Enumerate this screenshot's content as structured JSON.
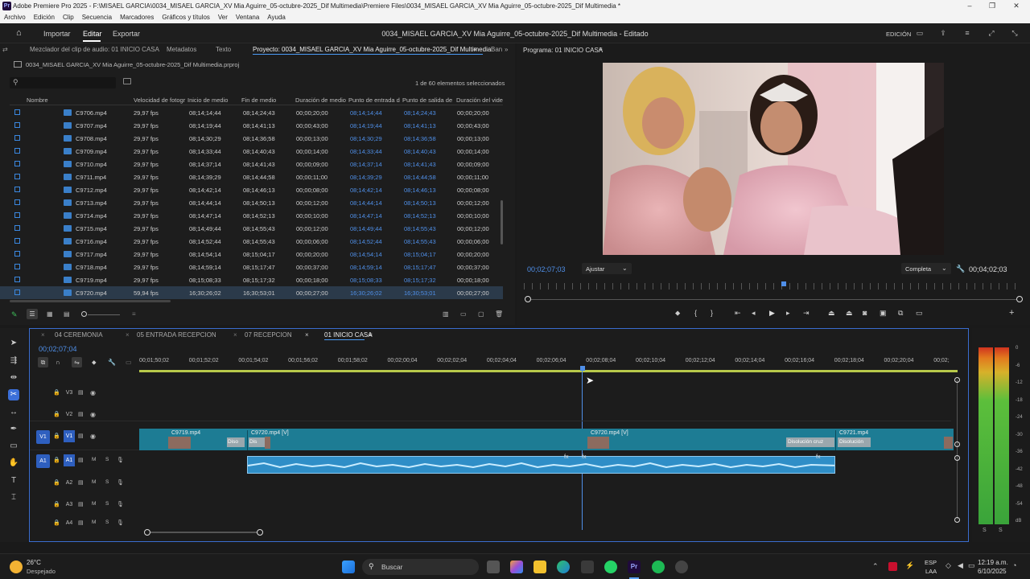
{
  "window": {
    "title": "Adobe Premiere Pro 2025 - F:\\MISAEL GARCIA\\0034_MISAEL GARCIA_XV Mia Aguirre_05-octubre-2025_Dif Multimedia\\Premiere Files\\0034_MISAEL GARCIA_XV Mia Aguirre_05-octubre-2025_Dif Multimedia *",
    "logo": "Pr"
  },
  "menu": [
    "Archivo",
    "Edición",
    "Clip",
    "Secuencia",
    "Marcadores",
    "Gráficos y títulos",
    "Ver",
    "Ventana",
    "Ayuda"
  ],
  "appbar": {
    "tabs": [
      "Importar",
      "Editar",
      "Exportar"
    ],
    "active_tab": "Editar",
    "project_title": "0034_MISAEL GARCIA_XV Mia Aguirre_05-octubre-2025_Dif Multimedia - Editado",
    "workspace": "EDICIÓN"
  },
  "project_panel": {
    "tabs": [
      "Mezclador del clip de audio: 01 INICIO CASA",
      "Metadatos",
      "Texto",
      "Proyecto: 0034_MISAEL GARCIA_XV Mia Aguirre_05-octubre-2025_Dif Multimedia",
      "Ban"
    ],
    "file": "0034_MISAEL GARCIA_XV Mia Aguirre_05-octubre-2025_Dif Multimedia.prproj",
    "selection_status": "1 de 60 elementos seleccionados",
    "columns": [
      "Nombre",
      "Velocidad de fotogr",
      "Inicio de medio",
      "Fin de medio",
      "Duración de medio",
      "Punto de entrada d",
      "Punto de salida de",
      "Duración del vide"
    ],
    "rows": [
      [
        "C9706.mp4",
        "29,97 fps",
        "08;14;14;44",
        "08;14;24;43",
        "00;00;20;00",
        "08;14;14;44",
        "08;14;24;43",
        "00;00;20;00"
      ],
      [
        "C9707.mp4",
        "29,97 fps",
        "08;14;19;44",
        "08;14;41;13",
        "00;00;43;00",
        "08;14;19;44",
        "08;14;41;13",
        "00;00;43;00"
      ],
      [
        "C9708.mp4",
        "29,97 fps",
        "08;14;30;29",
        "08;14;36;58",
        "00;00;13;00",
        "08;14;30;29",
        "08;14;36;58",
        "00;00;13;00"
      ],
      [
        "C9709.mp4",
        "29,97 fps",
        "08;14;33;44",
        "08;14;40;43",
        "00;00;14;00",
        "08;14;33;44",
        "08;14;40;43",
        "00;00;14;00"
      ],
      [
        "C9710.mp4",
        "29,97 fps",
        "08;14;37;14",
        "08;14;41;43",
        "00;00;09;00",
        "08;14;37;14",
        "08;14;41;43",
        "00;00;09;00"
      ],
      [
        "C9711.mp4",
        "29,97 fps",
        "08;14;39;29",
        "08;14;44;58",
        "00;00;11;00",
        "08;14;39;29",
        "08;14;44;58",
        "00;00;11;00"
      ],
      [
        "C9712.mp4",
        "29,97 fps",
        "08;14;42;14",
        "08;14;46;13",
        "00;00;08;00",
        "08;14;42;14",
        "08;14;46;13",
        "00;00;08;00"
      ],
      [
        "C9713.mp4",
        "29,97 fps",
        "08;14;44;14",
        "08;14;50;13",
        "00;00;12;00",
        "08;14;44;14",
        "08;14;50;13",
        "00;00;12;00"
      ],
      [
        "C9714.mp4",
        "29,97 fps",
        "08;14;47;14",
        "08;14;52;13",
        "00;00;10;00",
        "08;14;47;14",
        "08;14;52;13",
        "00;00;10;00"
      ],
      [
        "C9715.mp4",
        "29,97 fps",
        "08;14;49;44",
        "08;14;55;43",
        "00;00;12;00",
        "08;14;49;44",
        "08;14;55;43",
        "00;00;12;00"
      ],
      [
        "C9716.mp4",
        "29,97 fps",
        "08;14;52;44",
        "08;14;55;43",
        "00;00;06;00",
        "08;14;52;44",
        "08;14;55;43",
        "00;00;06;00"
      ],
      [
        "C9717.mp4",
        "29,97 fps",
        "08;14;54;14",
        "08;15;04;17",
        "00;00;20;00",
        "08;14;54;14",
        "08;15;04;17",
        "00;00;20;00"
      ],
      [
        "C9718.mp4",
        "29,97 fps",
        "08;14;59;14",
        "08;15;17;47",
        "00;00;37;00",
        "08;14;59;14",
        "08;15;17;47",
        "00;00;37;00"
      ],
      [
        "C9719.mp4",
        "29,97 fps",
        "08;15;08;33",
        "08;15;17;32",
        "00;00;18;00",
        "08;15;08;33",
        "08;15;17;32",
        "00;00;18;00"
      ],
      [
        "C9720.mp4",
        "59,94 fps",
        "16;30;26;02",
        "16;30;53;01",
        "00;00;27;00",
        "16;30;26;02",
        "16;30;53;01",
        "00;00;27;00"
      ]
    ]
  },
  "program_monitor": {
    "title": "Programa: 01 INICIO CASA",
    "timecode": "00;02;07;03",
    "fit": "Ajustar",
    "quality": "Completa",
    "duration": "00;04;02;03"
  },
  "timeline": {
    "tabs": [
      "04 CEREMONIA",
      "05 ENTRADA RECEPCION",
      "07 RECEPCION",
      "01 INICIO CASA"
    ],
    "active_tab": "01 INICIO CASA",
    "timecode": "00;02;07;04",
    "ruler": [
      "00;01;50;02",
      "00;01;52;02",
      "00;01;54;02",
      "00;01;56;02",
      "00;01;58;02",
      "00;02;00;04",
      "00;02;02;04",
      "00;02;04;04",
      "00;02;06;04",
      "00;02;08;04",
      "00;02;10;04",
      "00;02;12;04",
      "00;02;14;04",
      "00;02;16;04",
      "00;02;18;04",
      "00;02;20;04",
      "00;02;"
    ],
    "video_tracks": [
      "V3",
      "V2",
      "V1"
    ],
    "audio_tracks": [
      "A1",
      "A2",
      "A3",
      "A4"
    ],
    "clips": {
      "c1": "C9719.mp4",
      "c2": "C9720.mp4 [V]",
      "c3": "C9720.mp4 [V]",
      "c4": "C9721.mp4",
      "t1": "Diso",
      "t2": "Dis",
      "t3": "Disolución cruz",
      "t4": "Disolución"
    },
    "fx": "fx",
    "track_letters": {
      "m": "M",
      "s": "S"
    }
  },
  "meters": {
    "labels": [
      "0",
      "-6",
      "-12",
      "-18",
      "-24",
      "-30",
      "-36",
      "-42",
      "-48",
      "-54",
      "dB"
    ],
    "solo": [
      "S",
      "S"
    ]
  },
  "taskbar": {
    "weather_temp": "26°C",
    "weather_desc": "Despejado",
    "search": "Buscar",
    "lang": "ESP",
    "region": "LAA",
    "time": "12:19 a.m.",
    "date": "6/10/2025"
  }
}
